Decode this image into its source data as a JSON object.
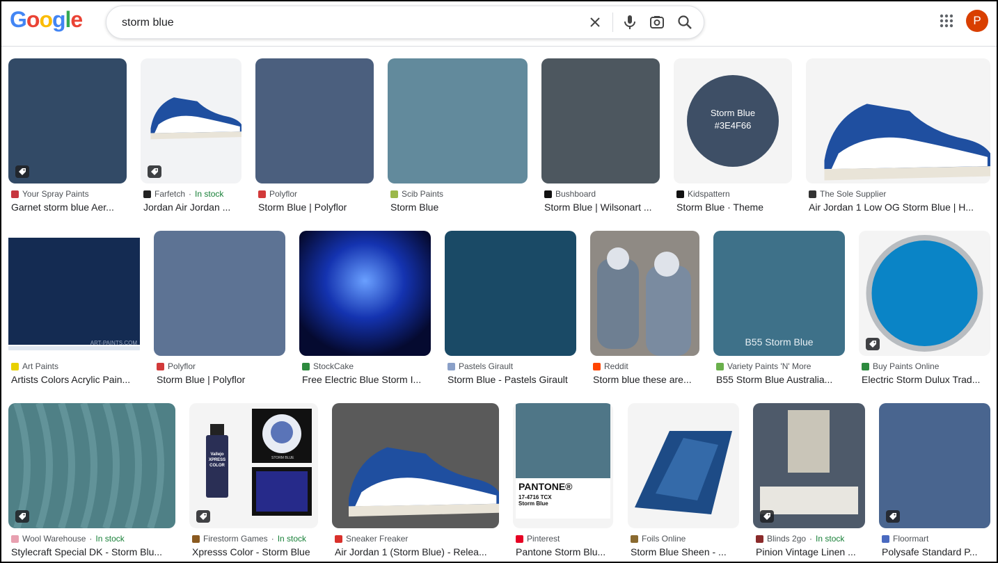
{
  "header": {
    "logo_letters": [
      {
        "ch": "G",
        "color": "#4285F4"
      },
      {
        "ch": "o",
        "color": "#EA4335"
      },
      {
        "ch": "o",
        "color": "#FBBC05"
      },
      {
        "ch": "g",
        "color": "#4285F4"
      },
      {
        "ch": "l",
        "color": "#34A853"
      },
      {
        "ch": "e",
        "color": "#EA4335"
      }
    ],
    "search_value": "storm blue",
    "avatar_letter": "P",
    "icons": [
      "close-icon",
      "mic-icon",
      "lens-icon",
      "search-icon",
      "apps-grid-icon"
    ]
  },
  "results": [
    {
      "source": "Your Spray Paints",
      "title": "Garnet storm blue Aer...",
      "stock": "",
      "shopping": true,
      "color": "#324a66",
      "fav": "#c7363f"
    },
    {
      "source": "Farfetch",
      "title": "Jordan Air Jordan ...",
      "stock": "In stock",
      "shopping": true,
      "color": "#f2f3f5",
      "fav": "#222222"
    },
    {
      "source": "Polyflor",
      "title": "Storm Blue | Polyflor",
      "stock": "",
      "shopping": false,
      "color": "#4b5f7e",
      "fav": "#d23a3a"
    },
    {
      "source": "Scib Paints",
      "title": "Storm Blue",
      "stock": "",
      "shopping": false,
      "color": "#628a9c",
      "fav": "#9bb84a"
    },
    {
      "source": "Bushboard",
      "title": "Storm Blue | Wilsonart ...",
      "stock": "",
      "shopping": false,
      "color": "#4d575f",
      "fav": "#111111"
    },
    {
      "source": "Kidspattern",
      "title": "Storm Blue · Theme",
      "stock": "",
      "shopping": false,
      "color": "#f4f4f4",
      "fav": "#111111",
      "circle_text": [
        "Storm Blue",
        "#3E4F66"
      ]
    },
    {
      "source": "The Sole Supplier",
      "title": "Air Jordan 1 Low OG Storm Blue | H...",
      "stock": "",
      "shopping": false,
      "color": "#f4f4f4",
      "fav": "#333333"
    },
    {
      "source": "Art Paints",
      "title": "Artists Colors Acrylic Pain...",
      "stock": "",
      "shopping": false,
      "color": "#142b52",
      "fav": "#e8d000",
      "watermark": "ART-PAINTS.COM"
    },
    {
      "source": "Polyflor",
      "title": "Storm Blue | Polyflor",
      "stock": "",
      "shopping": false,
      "color": "#5d7394",
      "fav": "#d23a3a"
    },
    {
      "source": "StockCake",
      "title": "Free Electric Blue Storm I...",
      "stock": "",
      "shopping": false,
      "color": "#1533a8",
      "fav": "#2d8a3e"
    },
    {
      "source": "Pastels Girault",
      "title": "Storm Blue - Pastels Girault",
      "stock": "",
      "shopping": false,
      "color": "#1a4a66",
      "fav": "#8aa0c8"
    },
    {
      "source": "Reddit",
      "title": "Storm blue these are...",
      "stock": "",
      "shopping": false,
      "color": "#6e7f92",
      "fav": "#ff4500"
    },
    {
      "source": "Variety Paints 'N' More",
      "title": "B55 Storm Blue Australia...",
      "stock": "",
      "shopping": false,
      "color": "#3e7189",
      "fav": "#6ab04c",
      "overlay_text": "B55 Storm Blue"
    },
    {
      "source": "Buy Paints Online",
      "title": "Electric Storm Dulux Trad...",
      "stock": "",
      "shopping": true,
      "color": "#f4f4f4",
      "fav": "#2d8a3e"
    },
    {
      "source": "Wool Warehouse",
      "title": "Stylecraft Special DK - Storm Blu...",
      "stock": "In stock",
      "shopping": true,
      "color": "#4f8086",
      "fav": "#e8a0b0"
    },
    {
      "source": "Firestorm Games",
      "title": "Xpresss Color - Storm Blue",
      "stock": "In stock",
      "shopping": true,
      "color": "#f4f4f4",
      "fav": "#8a5a20",
      "bottle_labels": [
        "Vallejo",
        "XPRESS COLOR",
        "STORM BLUE"
      ]
    },
    {
      "source": "Sneaker Freaker",
      "title": "Air Jordan 1 (Storm Blue) - Relea...",
      "stock": "",
      "shopping": false,
      "color": "#5a5a5a",
      "fav": "#d9302b"
    },
    {
      "source": "Pinterest",
      "title": "Pantone Storm Blu...",
      "stock": "",
      "shopping": false,
      "color": "#4f7687",
      "fav": "#e60023",
      "pantone": [
        "PANTONE®",
        "17-4716 TCX",
        "Storm Blue"
      ]
    },
    {
      "source": "Foils Online",
      "title": "Storm Blue Sheen - ...",
      "stock": "",
      "shopping": false,
      "color": "#f4f4f4",
      "fav": "#8a6a30"
    },
    {
      "source": "Blinds 2go",
      "title": "Pinion Vintage Linen ...",
      "stock": "In stock",
      "shopping": true,
      "color": "#4e5a6a",
      "fav": "#8a2a2a"
    },
    {
      "source": "Floormart",
      "title": "Polysafe Standard P...",
      "stock": "",
      "shopping": true,
      "color": "#49658f",
      "fav": "#4a6ac0"
    }
  ]
}
